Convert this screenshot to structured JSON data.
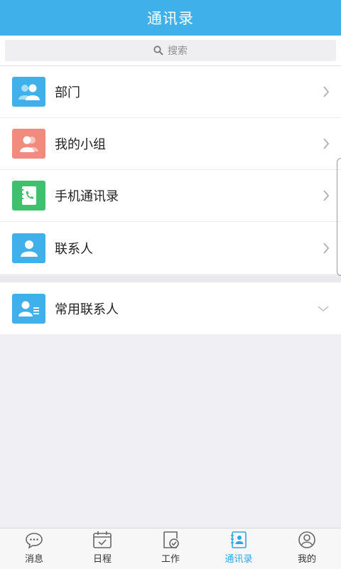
{
  "header": {
    "title": "通讯录"
  },
  "search": {
    "placeholder": "搜索"
  },
  "list": [
    {
      "label": "部门",
      "icon": "department-icon",
      "color": "#3fb0ea"
    },
    {
      "label": "我的小组",
      "icon": "group-icon",
      "color": "#f08b7e"
    },
    {
      "label": "手机通讯录",
      "icon": "phone-contacts-icon",
      "color": "#3ec06d"
    },
    {
      "label": "联系人",
      "icon": "contact-icon",
      "color": "#3fb0ea"
    }
  ],
  "favorites": {
    "label": "常用联系人",
    "icon": "frequent-contacts-icon",
    "color": "#3fb0ea"
  },
  "tabs": [
    {
      "label": "消息",
      "icon": "message-icon"
    },
    {
      "label": "日程",
      "icon": "calendar-icon"
    },
    {
      "label": "工作",
      "icon": "work-icon"
    },
    {
      "label": "通讯录",
      "icon": "contacts-icon",
      "active": true
    },
    {
      "label": "我的",
      "icon": "profile-icon"
    }
  ],
  "colors": {
    "accent": "#3fb0ea",
    "active_tab": "#29a8e6"
  }
}
